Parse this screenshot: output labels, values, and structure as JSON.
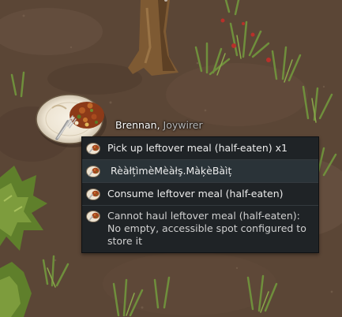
{
  "pawn": {
    "name": "Brennan",
    "separator": ", ",
    "title": "Joywirer"
  },
  "menu": {
    "options": [
      {
        "label": "Pick up leftover meal (half-eaten) x1",
        "icon": "meal-icon",
        "state": "normal"
      },
      {
        "label": "RèàłțìmèMèàłş.MàķèBàìț",
        "icon": "meal-icon",
        "state": "highlighted"
      },
      {
        "label": "Consume leftover meal (half-eaten)",
        "icon": "meal-icon",
        "state": "normal"
      },
      {
        "label": "Cannot haul leftover meal (half-eaten): No empty, accessible spot configured to store it",
        "icon": "meal-icon",
        "state": "disabled"
      }
    ]
  },
  "colors": {
    "menu_bg": "#1f2326",
    "menu_highlight": "#2a3338",
    "menu_text": "#ececec",
    "pawn_title": "#b8b8b8"
  }
}
